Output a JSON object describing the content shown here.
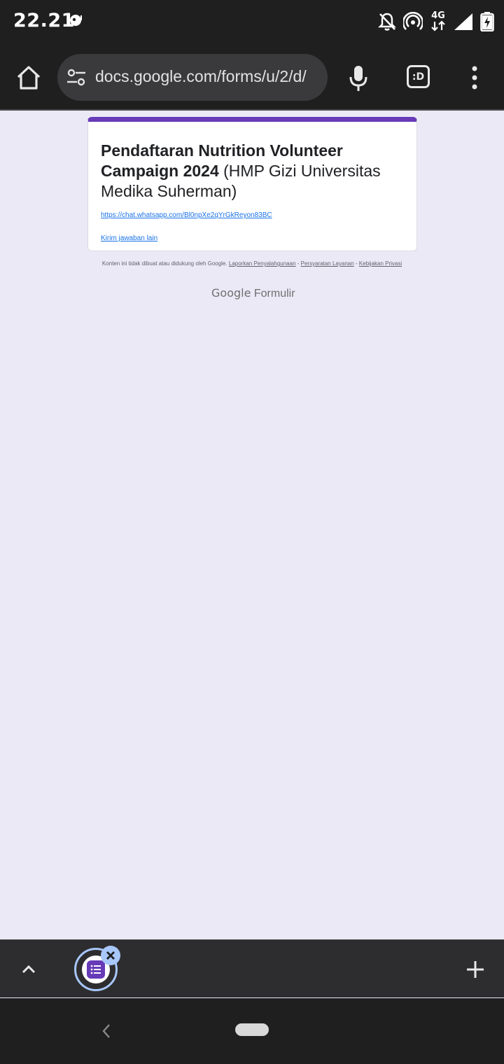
{
  "status_bar": {
    "time": "22.21",
    "network": "4G"
  },
  "browser": {
    "url": "docs.google.com/forms/u/2/d/",
    "tabs_label": ":D"
  },
  "form": {
    "title_bold": "Pendaftaran Nutrition Volunteer Campaign 2024",
    "title_rest": " (HMP Gizi Universitas Medika Suherman)",
    "link_text": "https://chat.whatsapp.com/Bl0npXe2qYrGkReyon83BC",
    "another_response": "Kirim jawaban lain",
    "accent_color": "#673ab7"
  },
  "footer": {
    "disclaimer": "Konten ini tidak dibuat atau didukung oleh Google.",
    "report_abuse": "Laporkan Penyalahgunaan",
    "separator": " - ",
    "terms": "Persyaratan Layanan",
    "privacy": "Kebijakan Privasi",
    "brand_google": "Google",
    "brand_product": "Formulir"
  },
  "icons": {
    "home": "home-icon",
    "site_settings": "tune-icon",
    "mic": "mic-icon",
    "menu": "more-vert-icon",
    "tab_forms": "google-forms-icon",
    "close": "close-icon",
    "new_tab": "plus-icon",
    "chevron": "chevron-up-icon"
  }
}
